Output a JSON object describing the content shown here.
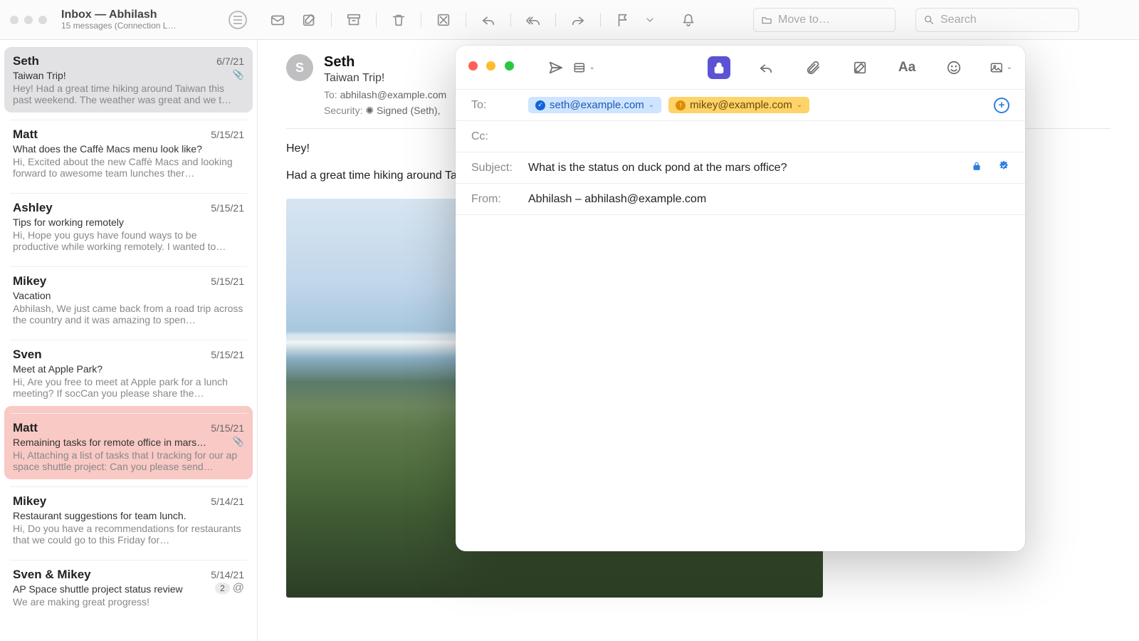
{
  "titlebar": {
    "title": "Inbox — Abhilash",
    "subtitle": "15 messages (Connection L…",
    "move_to_placeholder": "Move to…",
    "search_placeholder": "Search"
  },
  "messages": [
    {
      "sender": "Seth",
      "date": "6/7/21",
      "subject": "Taiwan Trip!",
      "preview": "Hey! Had a great time hiking around Taiwan this past weekend. The weather was great and we t…",
      "selected": true,
      "has_attachment": true
    },
    {
      "sender": "Matt",
      "date": "5/15/21",
      "subject": "What does the Caffè Macs menu look like?",
      "preview": "Hi, Excited about the new Caffè Macs and looking forward to awesome team lunches ther…"
    },
    {
      "sender": "Ashley",
      "date": "5/15/21",
      "subject": "Tips for working remotely",
      "preview": "Hi, Hope you guys have found ways to be productive while working remotely. I wanted to…"
    },
    {
      "sender": "Mikey",
      "date": "5/15/21",
      "subject": "Vacation",
      "preview": "Abhilash, We just came back from a road trip across the country and it was amazing to spen…"
    },
    {
      "sender": "Sven",
      "date": "5/15/21",
      "subject": "Meet at Apple Park?",
      "preview": "Hi, Are you free to meet at Apple park for a lunch meeting? If socCan you please share the…"
    },
    {
      "sender": "Matt",
      "date": "5/15/21",
      "subject": "Remaining tasks for remote office in mars…",
      "preview": "Hi, Attaching a list of tasks that I tracking for our ap space shuttle project: Can you please send…",
      "flagged": true,
      "has_attachment": true
    },
    {
      "sender": "Mikey",
      "date": "5/14/21",
      "subject": "Restaurant suggestions for team lunch.",
      "preview": "Hi, Do you have a recommendations for restaurants that we could go to this Friday for…"
    },
    {
      "sender": "Sven & Mikey",
      "date": "5/14/21",
      "subject": "AP Space shuttle project status review",
      "preview": "We are making great progress!",
      "count": "2",
      "mention": true
    }
  ],
  "reader": {
    "avatar_initial": "S",
    "sender": "Seth",
    "subject": "Taiwan Trip!",
    "to_label": "To:",
    "to_value": "abhilash@example.com",
    "security_label": "Security:",
    "security_value": "Signed (Seth),",
    "line1": "Hey!",
    "line2": "Had a great time hiking around Taiwan"
  },
  "compose": {
    "to_label": "To:",
    "cc_label": "Cc:",
    "subject_label": "Subject:",
    "from_label": "From:",
    "recipients": [
      {
        "email": "seth@example.com",
        "status": "verified"
      },
      {
        "email": "mikey@example.com",
        "status": "warning"
      }
    ],
    "subject_value": "What is the status on duck pond at the mars office?",
    "from_value": "Abhilash – abhilash@example.com"
  }
}
